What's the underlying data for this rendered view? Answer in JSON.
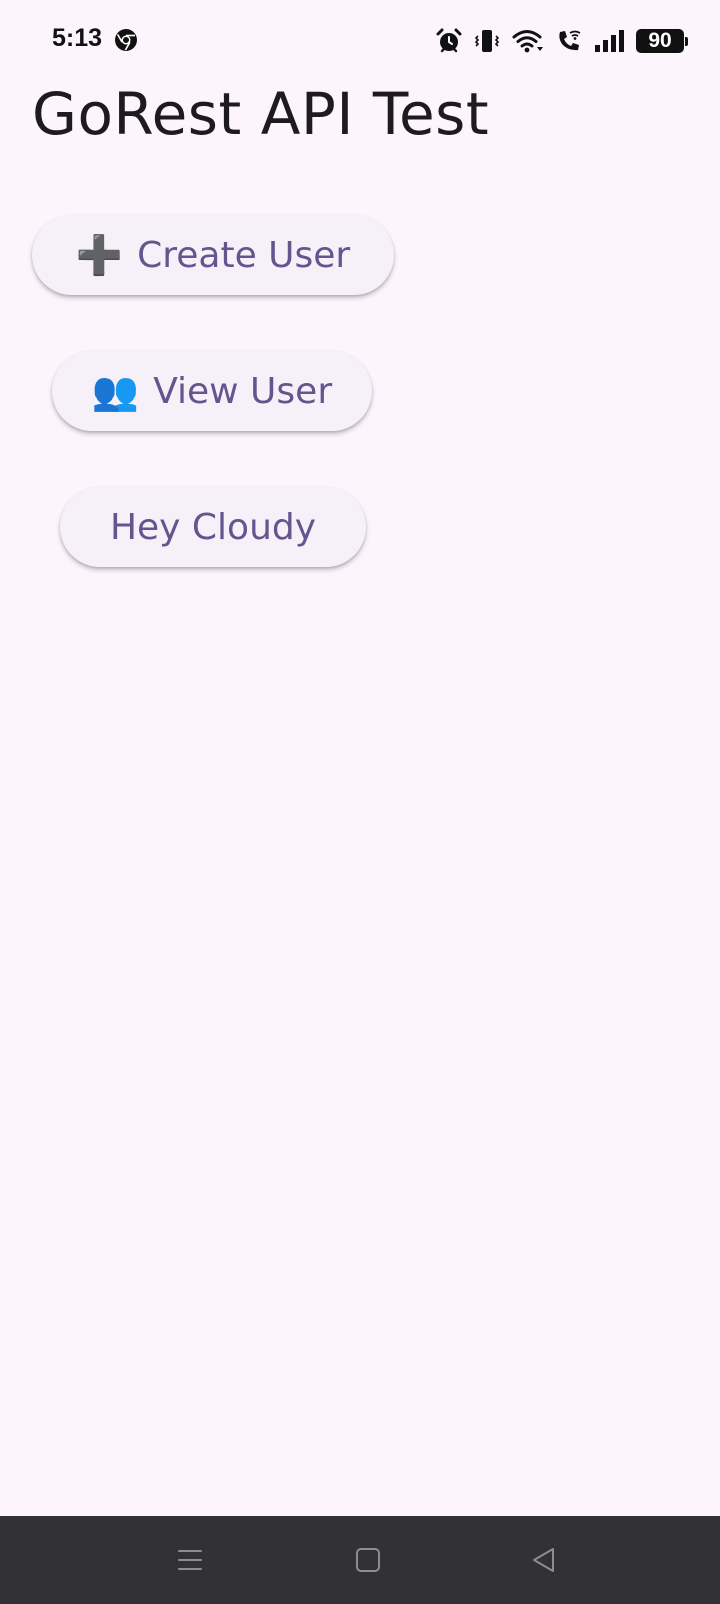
{
  "status_bar": {
    "time": "5:13",
    "app_icon": "chrome-icon",
    "icons": [
      "alarm-icon",
      "vibrate-icon",
      "wifi-icon",
      "wifi-call-icon",
      "signal-icon"
    ],
    "battery": "90"
  },
  "page": {
    "title": "GoRest API Test"
  },
  "buttons": {
    "create_user": {
      "emoji": "➕",
      "label": "Create User"
    },
    "view_user": {
      "emoji": "👥",
      "label": "View User"
    },
    "hey_cloudy": {
      "label": "Hey Cloudy"
    }
  },
  "nav_bar": {
    "items": [
      "menu-icon",
      "home-icon",
      "back-icon"
    ]
  },
  "colors": {
    "background": "#fcf5fc",
    "button_background": "#f6f1f8",
    "button_text": "#65558f",
    "nav_background": "#323135"
  }
}
